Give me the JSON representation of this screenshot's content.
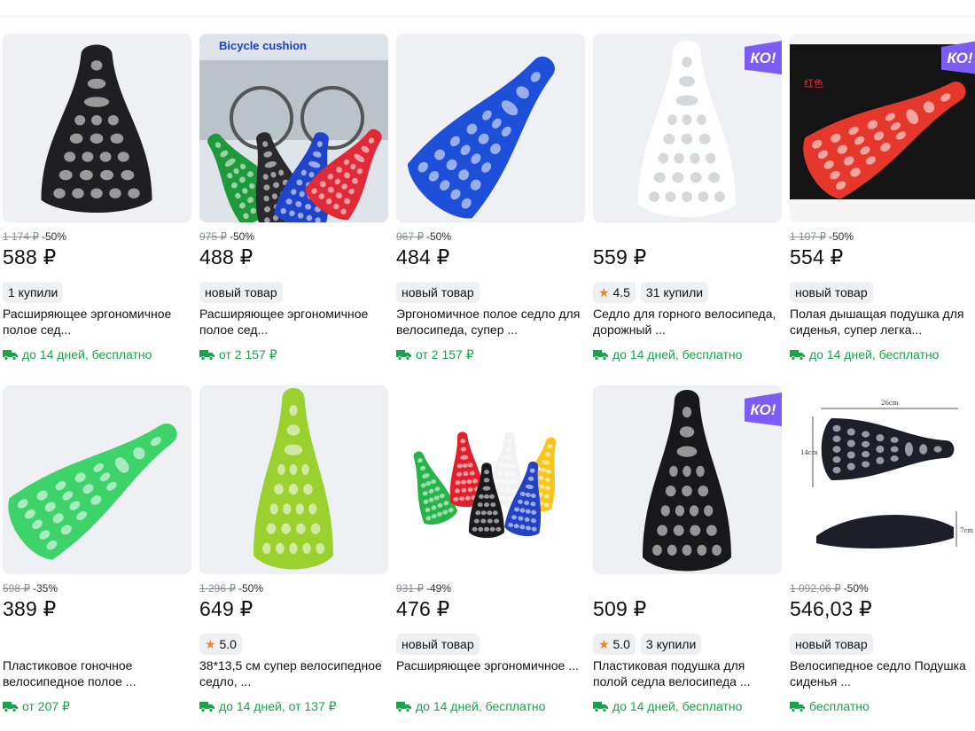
{
  "colors": {
    "accent_green": "#1aa34a",
    "ko_badge": "#7b5cf5",
    "star": "#f58220"
  },
  "products": [
    {
      "image": "black-saddle",
      "image_text": "",
      "ko": false,
      "old_price": "1 174 ₽",
      "discount": "-50%",
      "price": "588 ₽",
      "rating": "",
      "bought": "1 купили",
      "title": "Расширяющее эргономичное полое сед...",
      "delivery": "до 14 дней, бесплатно"
    },
    {
      "image": "multi-saddles-cyclist",
      "image_text": "Bicycle cushion",
      "ko": false,
      "old_price": "975 ₽",
      "discount": "-50%",
      "price": "488 ₽",
      "rating": "",
      "bought": "новый товар",
      "title": "Расширяющее эргономичное полое сед...",
      "delivery": "от 2 157 ₽"
    },
    {
      "image": "blue-saddle",
      "image_text": "",
      "ko": false,
      "old_price": "967 ₽",
      "discount": "-50%",
      "price": "484 ₽",
      "rating": "",
      "bought": "новый товар",
      "title": "Эргономичное полое седло для велосипеда, супер ...",
      "delivery": "от 2 157 ₽"
    },
    {
      "image": "white-saddle",
      "image_text": "",
      "ko": true,
      "old_price": "",
      "discount": "",
      "price": "559 ₽",
      "rating": "4.5",
      "bought": "31 купили",
      "title": "Седло для горного велосипеда, дорожный ...",
      "delivery": "до 14 дней, бесплатно"
    },
    {
      "image": "red-saddle",
      "image_text": "红色",
      "ko": true,
      "old_price": "1 107 ₽",
      "discount": "-50%",
      "price": "554 ₽",
      "rating": "",
      "bought": "новый товар",
      "title": "Полая дышащая подушка для сиденья, супер легка...",
      "delivery": "до 14 дней, бесплатно"
    },
    {
      "image": "green-saddle",
      "image_text": "",
      "ko": false,
      "old_price": "598 ₽",
      "discount": "-35%",
      "price": "389 ₽",
      "rating": "",
      "bought": "",
      "title": "Пластиковое гоночное велосипедное полое ...",
      "delivery": "от 207 ₽"
    },
    {
      "image": "lime-saddle",
      "image_text": "",
      "ko": false,
      "old_price": "1 296 ₽",
      "discount": "-50%",
      "price": "649 ₽",
      "rating": "5.0",
      "bought": "",
      "title": "38*13,5 см супер велосипедное седло, ...",
      "delivery": "до 14 дней, от 137 ₽"
    },
    {
      "image": "colorful-saddles",
      "image_text": "",
      "ko": false,
      "old_price": "931 ₽",
      "discount": "-49%",
      "price": "476 ₽",
      "rating": "",
      "bought": "новый товар",
      "title": "Расширяющее эргономичное ...",
      "delivery": "до 14 дней, бесплатно"
    },
    {
      "image": "black-saddle-top",
      "image_text": "",
      "ko": true,
      "old_price": "",
      "discount": "",
      "price": "509 ₽",
      "rating": "5.0",
      "bought": "3 купили",
      "title": "Пластиковая подушка для полой седла велосипеда ...",
      "delivery": "до 14 дней, бесплатно"
    },
    {
      "image": "black-saddle-dimensions",
      "image_text": "26cm|14cm|7cm",
      "ko": false,
      "old_price": "1 092,06 ₽",
      "discount": "-50%",
      "price": "546,03 ₽",
      "rating": "",
      "bought": "новый товар",
      "title": "Велосипедное седло Подушка сиденья ...",
      "delivery": "бесплатно"
    }
  ]
}
